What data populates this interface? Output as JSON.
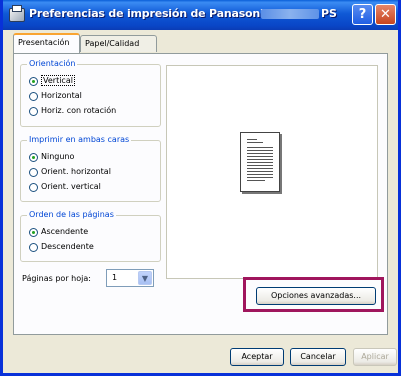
{
  "window": {
    "title": "Preferencias de impresión de Panasonic DP-",
    "title_suffix": "PS",
    "help_label": "?",
    "close_label": "✕"
  },
  "tabs": [
    {
      "label": "Presentación",
      "active": true
    },
    {
      "label": "Papel/Calidad",
      "active": false
    }
  ],
  "orientation": {
    "title": "Orientación",
    "options": [
      {
        "label": "Vertical",
        "selected": true
      },
      {
        "label": "Horizontal",
        "selected": false
      },
      {
        "label": "Horiz. con rotación",
        "selected": false
      }
    ]
  },
  "duplex": {
    "title": "Imprimir en ambas caras",
    "options": [
      {
        "label": "Ninguno",
        "selected": true
      },
      {
        "label": "Orient. horizontal",
        "selected": false
      },
      {
        "label": "Orient. vertical",
        "selected": false
      }
    ]
  },
  "page_order": {
    "title": "Orden de las páginas",
    "options": [
      {
        "label": "Ascendente",
        "selected": true
      },
      {
        "label": "Descendente",
        "selected": false
      }
    ]
  },
  "pages_per_sheet": {
    "label": "Páginas por hoja:",
    "value": "1",
    "arrow": "▼"
  },
  "buttons": {
    "advanced": "Opciones avanzadas...",
    "ok": "Aceptar",
    "cancel": "Cancelar",
    "apply": "Aplicar"
  },
  "colors": {
    "titlebar": "#0a5fd8",
    "highlight": "#a0165d",
    "group_title": "#0046d5"
  },
  "icons": {
    "app": "printer-icon",
    "help": "help-icon",
    "close": "close-icon",
    "preview": "document-page-icon"
  }
}
